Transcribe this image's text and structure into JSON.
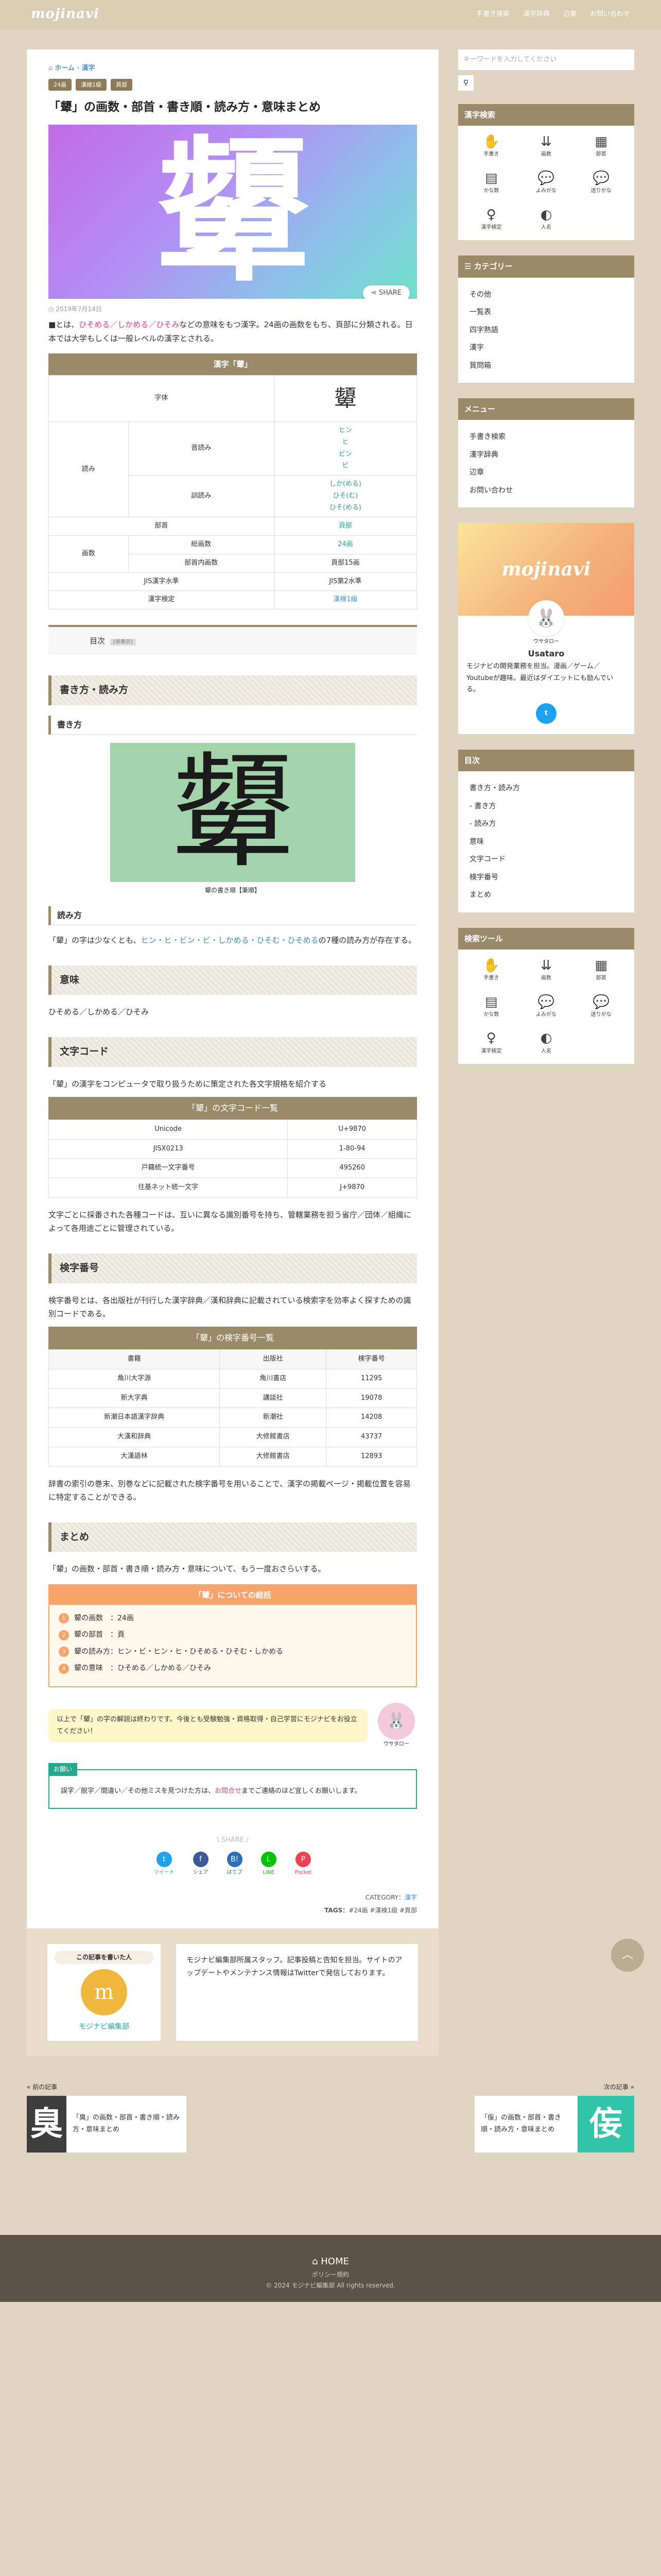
{
  "site": {
    "logo": "mojinavi",
    "nav": [
      "手書き検索",
      "漢字辞典",
      "辺章",
      "お問い合わせ"
    ]
  },
  "breadcrumb": {
    "home": "ホーム",
    "sep": "›",
    "cat": "漢字"
  },
  "tags": [
    "24画",
    "漢検1級",
    "頁部"
  ],
  "title": "「顰」の画数・部首・書き順・読み方・意味まとめ",
  "hero": {
    "kanji": "顰",
    "share": "SHARE"
  },
  "date": "2019年7月14日",
  "intro": {
    "a": "■とは、",
    "links": "ひそめる／しかめる／ひそみ",
    "b": "などの意味をもつ漢字。24画の画数をもち、頁部に分類される。日本では大学もしくは一般レベルの漢字とされる。"
  },
  "kt": {
    "caption": "漢字「顰」",
    "glyph_l": "字体",
    "glyph": "顰",
    "yomi": "読み",
    "on_l": "音読み",
    "on": [
      "ヒン",
      "ヒ",
      "ビン",
      "ビ"
    ],
    "kun_l": "訓読み",
    "kun": [
      "しか(める)",
      "ひそ(む)",
      "ひそ(める)"
    ],
    "bushu_l": "部首",
    "bushu": "頁部",
    "kakusu": "画数",
    "soukaku_l": "総画数",
    "soukaku": "24画",
    "bunai_l": "部首内画数",
    "bunai": "頁部15画",
    "jis_l": "JIS漢字水準",
    "jis": "JIS第2水準",
    "kentei_l": "漢字検定",
    "kentei": "漢検1級"
  },
  "toc": {
    "label": "目次",
    "btn": "[非表示]"
  },
  "s1": {
    "h": "書き方・読み方",
    "h3a": "書き方",
    "cap": "顰の書き順【筆順】",
    "h3b": "読み方",
    "txt1": "「顰」の字は少なくとも、",
    "reads": "ヒン・ヒ・ビン・ビ・しかめる・ひそむ・ひそめる",
    "txt2": "の7種の読み方が存在する。"
  },
  "s2": {
    "h": "意味",
    "txt": "ひそめる／しかめる／ひそみ"
  },
  "s3": {
    "h": "文字コード",
    "txt": "「顰」の漢字をコンピュータで取り扱うために策定された各文字規格を紹介する",
    "caption": "「顰」の文字コード一覧",
    "rows": [
      [
        "Unicode",
        "U+9870"
      ],
      [
        "JISX0213",
        "1-80-94"
      ],
      [
        "戸籍統一文字番号",
        "495260"
      ],
      [
        "住基ネット統一文字",
        "J+9870"
      ]
    ],
    "after": "文字ごとに採番された各種コードは、互いに異なる識別番号を持ち、管轄業務を担う省庁／団体／組織によって各用途ごとに管理されている。"
  },
  "s4": {
    "h": "検字番号",
    "txt": "検字番号とは、各出版社が刊行した漢字辞典／漢和辞典に記載されている検索字を効率よく探すための識別コードである。",
    "caption": "「顰」の検字番号一覧",
    "head": [
      "書籍",
      "出版社",
      "検字番号"
    ],
    "rows": [
      [
        "角川大字源",
        "角川書店",
        "11295"
      ],
      [
        "新大字典",
        "講談社",
        "19078"
      ],
      [
        "新潮日本語漢字辞典",
        "新潮社",
        "14208"
      ],
      [
        "大漢和辞典",
        "大修館書店",
        "43737"
      ],
      [
        "大漢語林",
        "大修館書店",
        "12893"
      ]
    ],
    "after": "辞書の索引の巻末、別巻などに記載された検字番号を用いることで、漢字の掲載ページ・掲載位置を容易に特定することができる。"
  },
  "s5": {
    "h": "まとめ",
    "txt": "「顰」の画数・部首・書き順・読み方・意味について、もう一度おさらいする。",
    "box": "「顰」についての総括",
    "items": [
      "顰の画数　：24画",
      "顰の部首　：頁",
      "顰の読み方：ヒン・ビ・ヒン・ヒ・ひそめる・ひそむ・しかめる",
      "顰の意味　：ひそめる／しかめる／ひそみ"
    ]
  },
  "balloon": {
    "txt": "以上で「顰」の字の解説は終わりです。今後とも受験勉強・資格取得・自己学習にモジナビをお役立てください！",
    "name": "ウサタロー"
  },
  "note": {
    "label": "お願い",
    "a": "誤字／脱字／間違い／その他ミスを見つけた方は、",
    "link": "お問合せ",
    "b": "までご連絡のほど宜しくお願いします。"
  },
  "share": {
    "label": "SHARE",
    "btns": [
      {
        "t": "ツイート",
        "c": "#1da1f2",
        "i": "t"
      },
      {
        "t": "シェア",
        "c": "#3b5998",
        "i": "f"
      },
      {
        "t": "はてブ",
        "c": "#2c6ebd",
        "i": "B!"
      },
      {
        "t": "LINE",
        "c": "#00c300",
        "i": "L"
      },
      {
        "t": "Pocket",
        "c": "#ef4056",
        "i": "P"
      }
    ]
  },
  "meta": {
    "cat_l": "CATEGORY：",
    "cat": "漢字",
    "tags_l": "TAGS：",
    "tags": "#24画 #漢検1級 #頁部"
  },
  "author": {
    "label": "この記事を書いた人",
    "name": "モジナビ編集部",
    "desc": "モジナビ編集部所属スタッフ。記事投稿と告知を担当。サイトのアップデートやメンテナンス情報はTwitterで発信しております。"
  },
  "side": {
    "search_ph": "キーワードを入力してください",
    "kanji_h": "漢字検索",
    "kanji_tools": [
      [
        "✋",
        "手書き"
      ],
      [
        "⇊",
        "画数"
      ],
      [
        "▦",
        "部首"
      ],
      [
        "▤",
        "かな数"
      ],
      [
        "💬",
        "よみがな"
      ],
      [
        "💬",
        "送りがな"
      ],
      [
        "♀",
        "漢字検定"
      ],
      [
        "◐",
        "人名"
      ]
    ],
    "cat_h": "カテゴリー",
    "cats": [
      "その他",
      "一覧表",
      "四字熟語",
      "漢字",
      "質問箱"
    ],
    "menu_h": "メニュー",
    "menu": [
      "手書き検索",
      "漢字辞典",
      "辺章",
      "お問い合わせ"
    ],
    "promo": "mojinavi",
    "prof_ja": "ウサタロー",
    "prof_name": "Usataro",
    "prof_txt": "モジナビの開発業務を担当。漫画／ゲーム／Youtubeが趣味。最近はダイエットにも励んでいる。",
    "toc_h": "目次",
    "toc": [
      "書き方・読み方",
      "- 書き方",
      "- 読み方",
      "意味",
      "文字コード",
      "検字番号",
      "まとめ"
    ],
    "tool_h": "検索ツール"
  },
  "prevnext": {
    "prev_l": "« 前の記事",
    "prev_k": "臭",
    "prev_t": "「臭」の画数・部首・書き順・読み方・意味まとめ",
    "next_l": "次の記事 »",
    "next_k": "侫",
    "next_t": "「侫」の画数・部首・書き順・読み方・意味まとめ"
  },
  "footer": {
    "home": "HOME",
    "policy": "ポリシー規約",
    "copy": "© 2024 モジナビ編集部 All rights reserved."
  }
}
